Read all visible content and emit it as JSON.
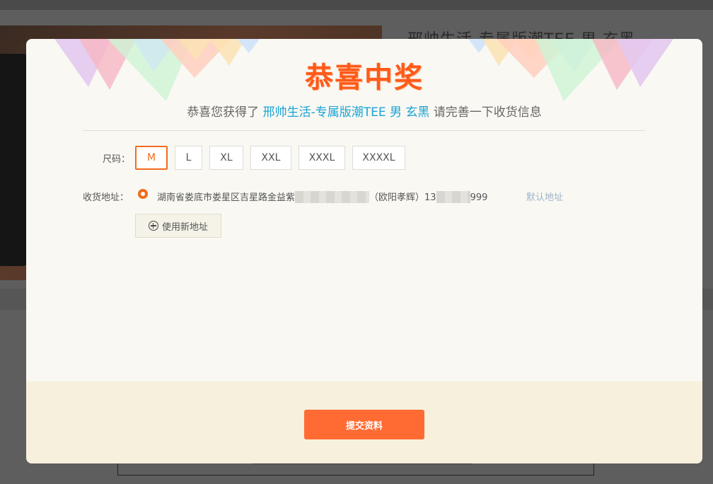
{
  "background_page": {
    "product_title": "邢帅生活-专属版潮TEE 男 玄黑"
  },
  "modal": {
    "title": "恭喜中奖",
    "subtitle_prefix": "恭喜您获得了",
    "product_name": "邢帅生活-专属版潮TEE 男 玄黑",
    "subtitle_suffix": "请完善一下收货信息",
    "size_label": "尺码：",
    "sizes": [
      "M",
      "L",
      "XL",
      "XXL",
      "XXXL",
      "XXXXL"
    ],
    "selected_size": "M",
    "address_label": "收货地址：",
    "address": {
      "text_start": "湖南省娄底市娄星区吉星路金益紫",
      "text_mid": "（欧阳孝辉）13",
      "text_end": "999",
      "default_tag": "默认地址"
    },
    "new_address_button": "使用新地址",
    "submit_button": "提交资料"
  },
  "colors": {
    "accent": "#ff6b33",
    "title": "#ff5a1a",
    "link": "#1aa3d4",
    "footer": "#f6f0dc"
  }
}
